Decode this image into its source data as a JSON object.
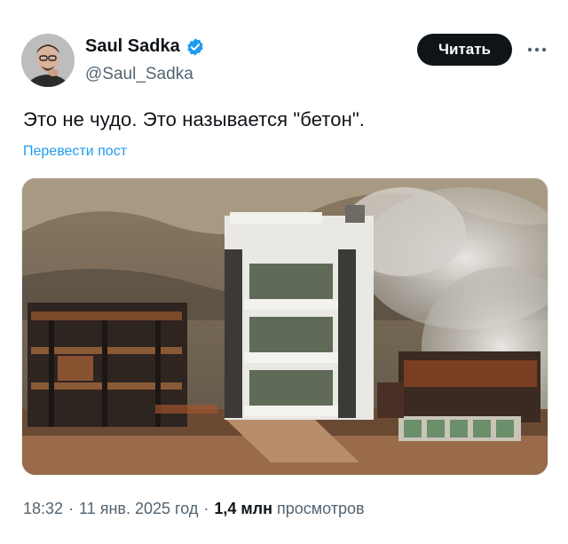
{
  "author": {
    "display_name": "Saul Sadka",
    "handle": "@Saul_Sadka",
    "verified": true,
    "avatar_icon": "person-avatar"
  },
  "actions": {
    "follow_label": "Читать",
    "more_icon": "more-horizontal-icon"
  },
  "post": {
    "text": "Это не чудо. Это называется \"бетон\".",
    "translate_label": "Перевести пост",
    "media_icon": "photo-burned-beach-houses"
  },
  "meta": {
    "time": "18:32",
    "separator": "·",
    "date": "11 янв. 2025 год",
    "views_count": "1,4 млн",
    "views_label": "просмотров"
  },
  "colors": {
    "link": "#1d9bf0",
    "verified_badge": "#1d9bf0",
    "follow_button_bg": "#0f1419",
    "secondary_text": "#536471"
  }
}
